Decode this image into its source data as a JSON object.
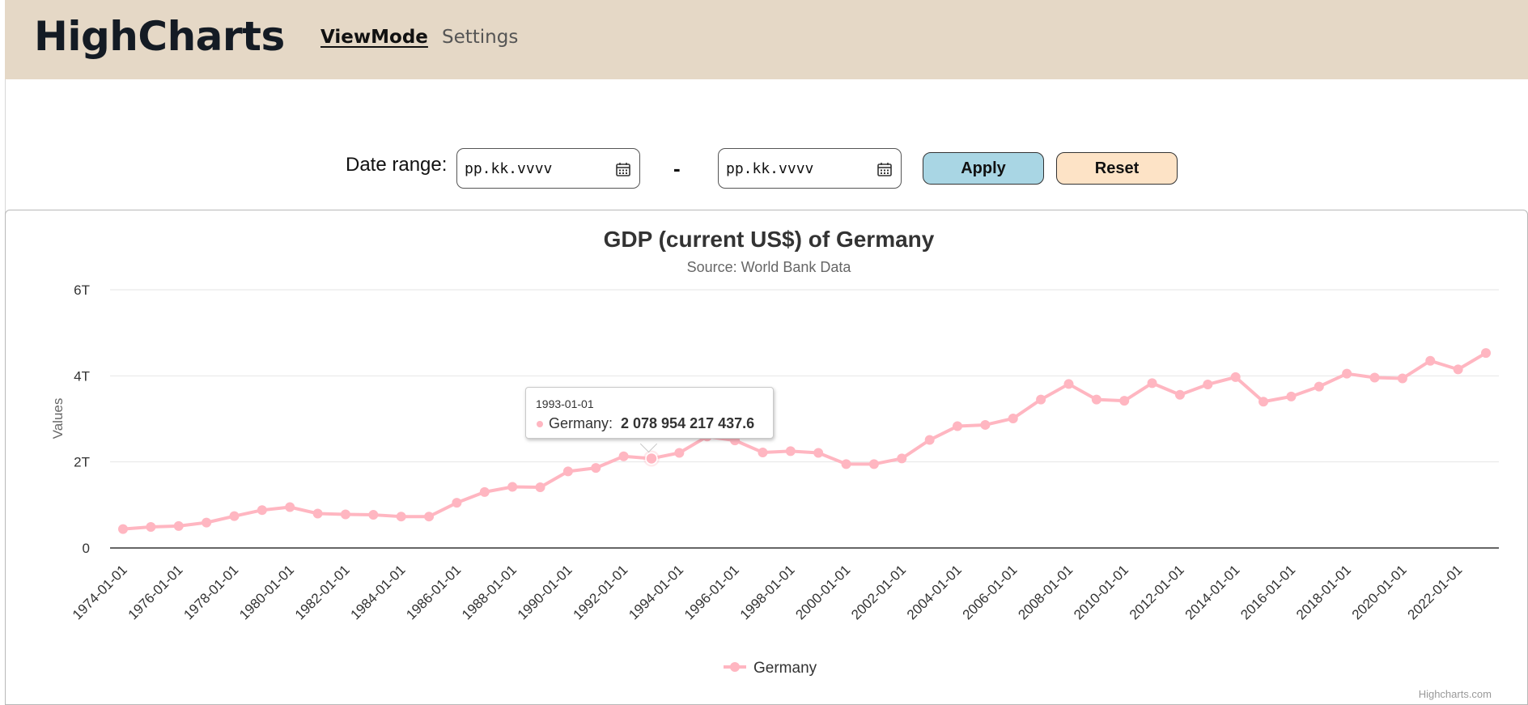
{
  "header": {
    "brand": "HighCharts",
    "nav": [
      {
        "label": "ViewMode",
        "active": true
      },
      {
        "label": "Settings",
        "active": false
      }
    ],
    "background_color": "#e5d8c6"
  },
  "toolbar": {
    "date_range_label": "Date range:",
    "start_placeholder": "pp.kk.vvvv",
    "separator": "-",
    "end_placeholder": "pp.kk.vvvv",
    "apply_label": "Apply",
    "reset_label": "Reset",
    "apply_color": "#a9d6e4",
    "reset_color": "#fde3c6"
  },
  "tooltip": {
    "date": "1993-01-01",
    "series_label": "Germany:",
    "value": "2 078 954 217 437.6"
  },
  "credits": "Highcharts.com",
  "chart_data": {
    "type": "line",
    "title": "GDP (current US$) of Germany",
    "subtitle": "Source: World Bank Data",
    "ylabel": "Values",
    "ylim": [
      0,
      6000000000000
    ],
    "yticks": [
      {
        "value": 0,
        "label": "0"
      },
      {
        "value": 2000000000000,
        "label": "2T"
      },
      {
        "value": 4000000000000,
        "label": "4T"
      },
      {
        "value": 6000000000000,
        "label": "6T"
      }
    ],
    "xlim": [
      "1974-01-01",
      "2023-01-01"
    ],
    "xtick_labels": [
      "1974-01-01",
      "1976-01-01",
      "1978-01-01",
      "1980-01-01",
      "1982-01-01",
      "1984-01-01",
      "1986-01-01",
      "1988-01-01",
      "1990-01-01",
      "1992-01-01",
      "1994-01-01",
      "1996-01-01",
      "1998-01-01",
      "2000-01-01",
      "2002-01-01",
      "2004-01-01",
      "2006-01-01",
      "2008-01-01",
      "2010-01-01",
      "2012-01-01",
      "2014-01-01",
      "2016-01-01",
      "2018-01-01",
      "2020-01-01",
      "2022-01-01"
    ],
    "grid": true,
    "legend_position": "bottom-center",
    "series": [
      {
        "name": "Germany",
        "color": "#ffb6c1",
        "x": [
          "1974-01-01",
          "1975-01-01",
          "1976-01-01",
          "1977-01-01",
          "1978-01-01",
          "1979-01-01",
          "1980-01-01",
          "1981-01-01",
          "1982-01-01",
          "1983-01-01",
          "1984-01-01",
          "1985-01-01",
          "1986-01-01",
          "1987-01-01",
          "1988-01-01",
          "1989-01-01",
          "1990-01-01",
          "1991-01-01",
          "1992-01-01",
          "1993-01-01",
          "1994-01-01",
          "1995-01-01",
          "1996-01-01",
          "1997-01-01",
          "1998-01-01",
          "1999-01-01",
          "2000-01-01",
          "2001-01-01",
          "2002-01-01",
          "2003-01-01",
          "2004-01-01",
          "2005-01-01",
          "2006-01-01",
          "2007-01-01",
          "2008-01-01",
          "2009-01-01",
          "2010-01-01",
          "2011-01-01",
          "2012-01-01",
          "2013-01-01",
          "2014-01-01",
          "2015-01-01",
          "2016-01-01",
          "2017-01-01",
          "2018-01-01",
          "2019-01-01",
          "2020-01-01",
          "2021-01-01",
          "2022-01-01",
          "2023-01-01"
        ],
        "values": [
          440000000000,
          490000000000,
          510000000000,
          590000000000,
          740000000000,
          880000000000,
          950000000000,
          800000000000,
          780000000000,
          770000000000,
          730000000000,
          730000000000,
          1050000000000,
          1300000000000,
          1420000000000,
          1410000000000,
          1780000000000,
          1860000000000,
          2130000000000,
          2078954217437.6,
          2210000000000,
          2590000000000,
          2500000000000,
          2220000000000,
          2250000000000,
          2210000000000,
          1950000000000,
          1950000000000,
          2080000000000,
          2510000000000,
          2830000000000,
          2860000000000,
          3010000000000,
          3450000000000,
          3810000000000,
          3450000000000,
          3420000000000,
          3830000000000,
          3560000000000,
          3800000000000,
          3970000000000,
          3400000000000,
          3520000000000,
          3750000000000,
          4050000000000,
          3960000000000,
          3940000000000,
          4350000000000,
          4150000000000,
          4530000000000
        ]
      }
    ],
    "highlighted_point": "1993-01-01"
  }
}
